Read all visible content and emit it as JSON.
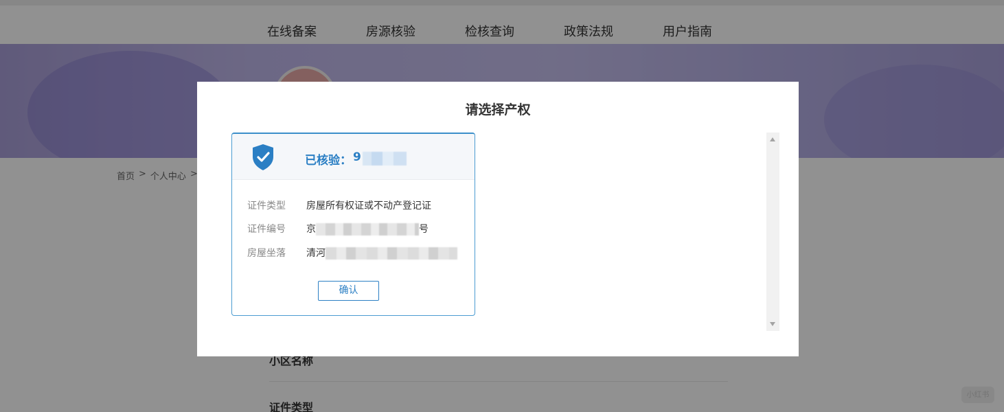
{
  "nav": {
    "items": [
      "在线备案",
      "房源核验",
      "检核查询",
      "政策法规",
      "用户指南"
    ]
  },
  "breadcrumb": {
    "items": [
      "首页",
      ">",
      "个人中心",
      ">"
    ]
  },
  "background_form": {
    "label_1": "小区名称",
    "label_2": "证件类型"
  },
  "modal": {
    "title": "请选择产权",
    "card": {
      "verified_label": "已核验：",
      "verified_value_visible": "9",
      "rows": [
        {
          "key": "证件类型",
          "value": "房屋所有权证或不动产登记证"
        },
        {
          "key": "证件编号",
          "value_prefix": "京",
          "value_suffix": "号"
        },
        {
          "key": "房屋坐落",
          "value_prefix": "清河"
        }
      ],
      "confirm_label": "确认"
    }
  },
  "colors": {
    "accent": "#2b7fc4",
    "card_border": "#4a9bd1"
  },
  "icons": {
    "verified": "shield-check-icon",
    "scroll_up": "scroll-up-arrow-icon",
    "scroll_down": "scroll-down-arrow-icon"
  }
}
